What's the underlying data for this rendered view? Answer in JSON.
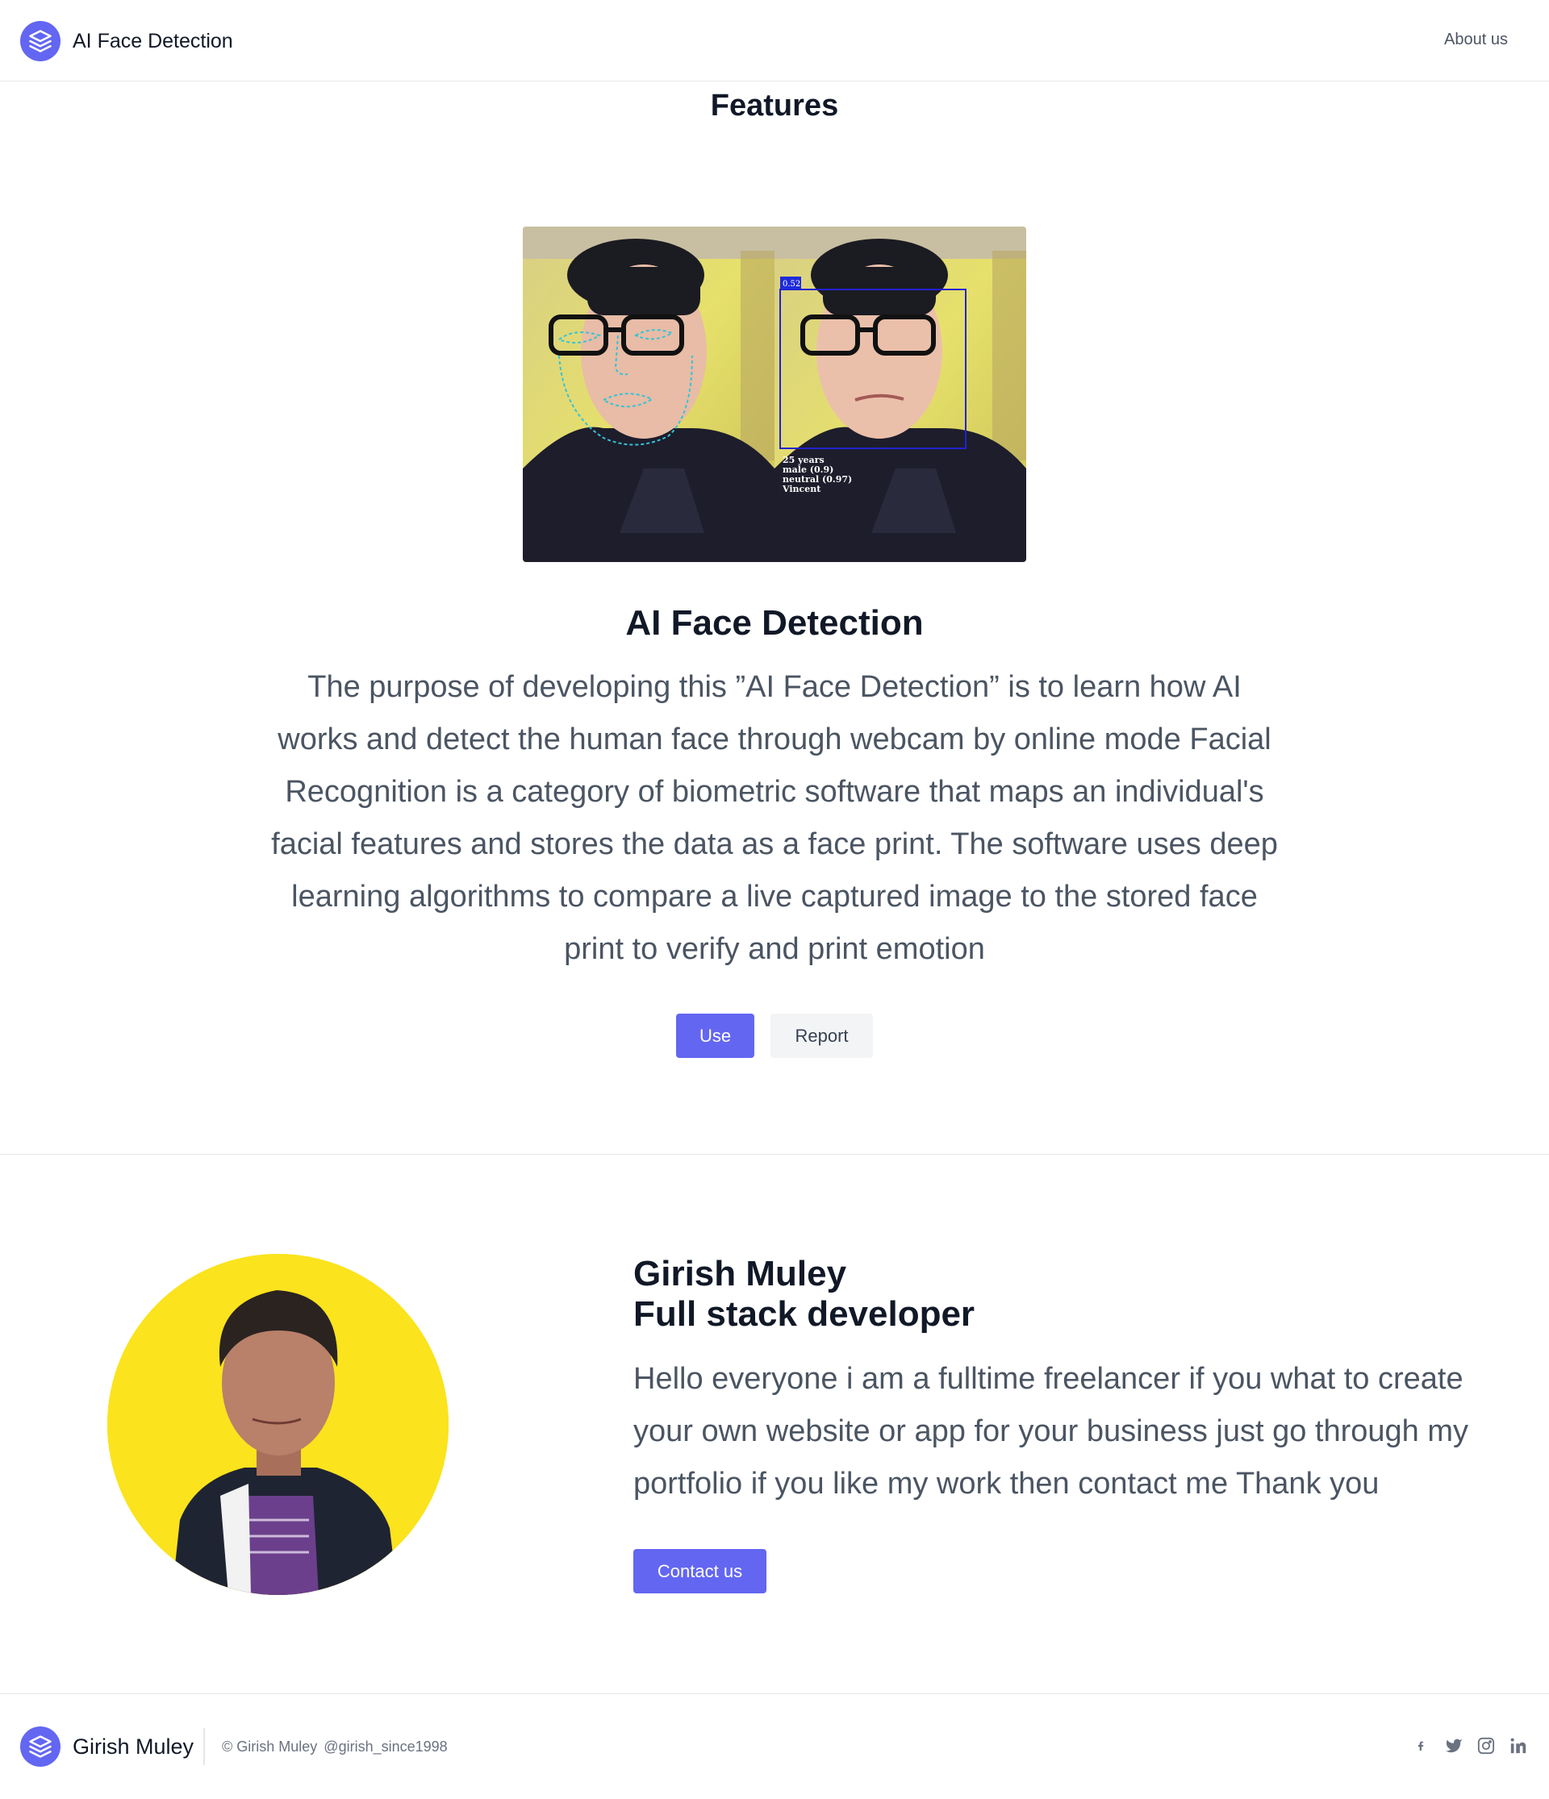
{
  "header": {
    "brand": "AI Face Detection",
    "nav_about": "About us"
  },
  "features": {
    "heading": "Features",
    "image_overlay": {
      "score": "0.52",
      "labels": [
        "25 years",
        "male (0.9)",
        "neutral (0.97)",
        "Vincent"
      ]
    },
    "title": "AI Face Detection",
    "description": "The purpose of developing this ”AI Face Detection” is to learn how AI works and detect the human face through webcam by online mode Facial Recognition is a category of biometric software that maps an individual's facial features and stores the data as a face print. The software uses deep learning algorithms to compare a live captured image to the stored face print to verify and print emotion",
    "use_label": "Use",
    "report_label": "Report"
  },
  "profile": {
    "name": "Girish Muley",
    "role": "Full stack developer",
    "bio": "Hello everyone i am a fulltime freelancer if you what to create your own website or app for your business just go through my portfolio if you like my work then contact me Thank you",
    "contact_label": "Contact us"
  },
  "footer": {
    "name": "Girish Muley",
    "copyright": "© Girish Muley",
    "handle": "@girish_since1998",
    "social_icons": [
      "facebook-icon",
      "twitter-icon",
      "instagram-icon",
      "linkedin-icon"
    ]
  },
  "colors": {
    "accent": "#6366f1",
    "avatar_bg": "#fbe31d"
  }
}
